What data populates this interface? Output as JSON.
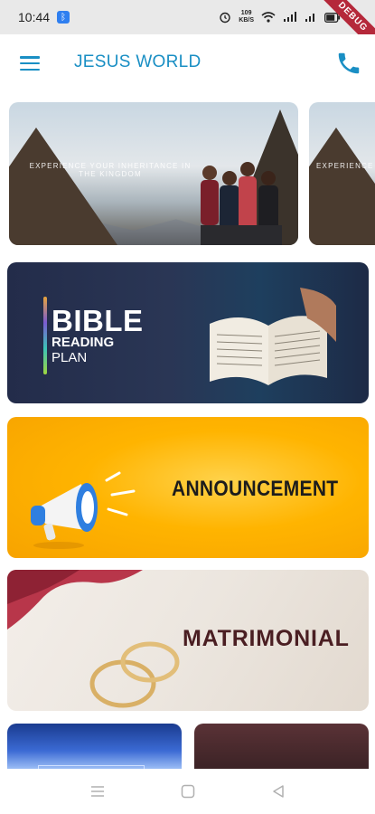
{
  "status_bar": {
    "time": "10:44",
    "bluetooth_icon": "bluetooth-icon",
    "data_speed": "109\nKB/S",
    "icons": [
      "alarm-icon",
      "speed-icon",
      "wifi-icon",
      "signal-icon",
      "signal-icon",
      "battery-icon"
    ],
    "ribbon": "DEBUG"
  },
  "app_bar": {
    "title": "JESUS WORLD",
    "menu_icon": "menu-icon",
    "call_icon": "phone-icon",
    "accent": "#1a8fc4"
  },
  "carousel": {
    "slides": [
      {
        "caption": "EXPERIENCE YOUR INHERITANCE IN THE KINGDOM"
      },
      {
        "caption": "EXPERIENCE"
      }
    ]
  },
  "banners": {
    "bible": {
      "title": "BIBLE",
      "line1": "READING",
      "line2": "PLAN"
    },
    "announcement": {
      "label": "ANNOUNCEMENT"
    },
    "matrimonial": {
      "label": "MATRIMONIAL"
    }
  },
  "nav_bar": {
    "icons": [
      "menu-nav-icon",
      "home-nav-icon",
      "back-nav-icon"
    ]
  }
}
